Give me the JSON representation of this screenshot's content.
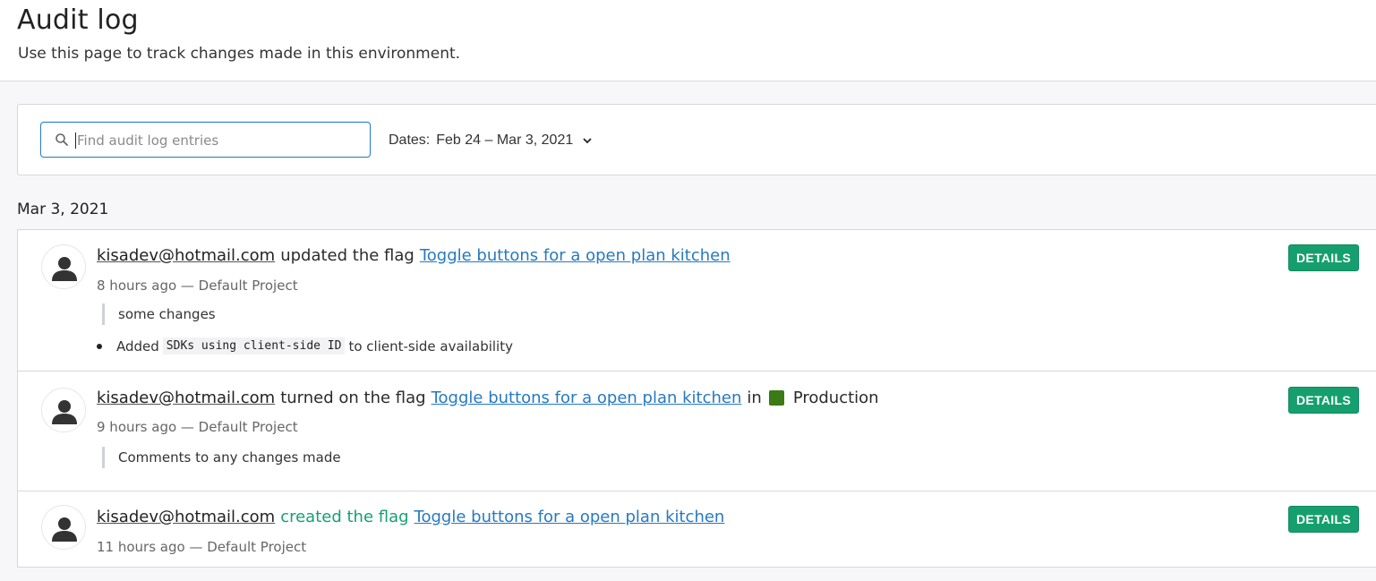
{
  "header": {
    "title": "Audit log",
    "subtitle": "Use this page to track changes made in this environment."
  },
  "filters": {
    "search_placeholder": "Find audit log entries",
    "search_value": "",
    "dates_label": "Dates:",
    "dates_value": "Feb 24 – Mar 3, 2021"
  },
  "date_group": "Mar 3, 2021",
  "entries": [
    {
      "user": "kisadev@hotmail.com",
      "action": "updated the flag",
      "flag": "Toggle buttons for a open plan kitchen",
      "meta": "8 hours ago — Default Project",
      "comment": "some changes",
      "change_prefix": "Added",
      "change_code": "SDKs using client-side ID",
      "change_suffix": "to client-side availability",
      "details_label": "DETAILS"
    },
    {
      "user": "kisadev@hotmail.com",
      "action": "turned on the flag",
      "flag": "Toggle buttons for a open plan kitchen",
      "in_word": "in",
      "environment": "Production",
      "environment_color": "#3b7a14",
      "meta": "9 hours ago — Default Project",
      "comment": "Comments to any changes made",
      "details_label": "DETAILS"
    },
    {
      "user": "kisadev@hotmail.com",
      "action": "created the flag",
      "action_color": "#16a070",
      "flag": "Toggle buttons for a open plan kitchen",
      "meta": "11 hours ago — Default Project",
      "details_label": "DETAILS"
    }
  ],
  "colors": {
    "accent_link": "#2679c2",
    "button_green": "#169f6e"
  }
}
